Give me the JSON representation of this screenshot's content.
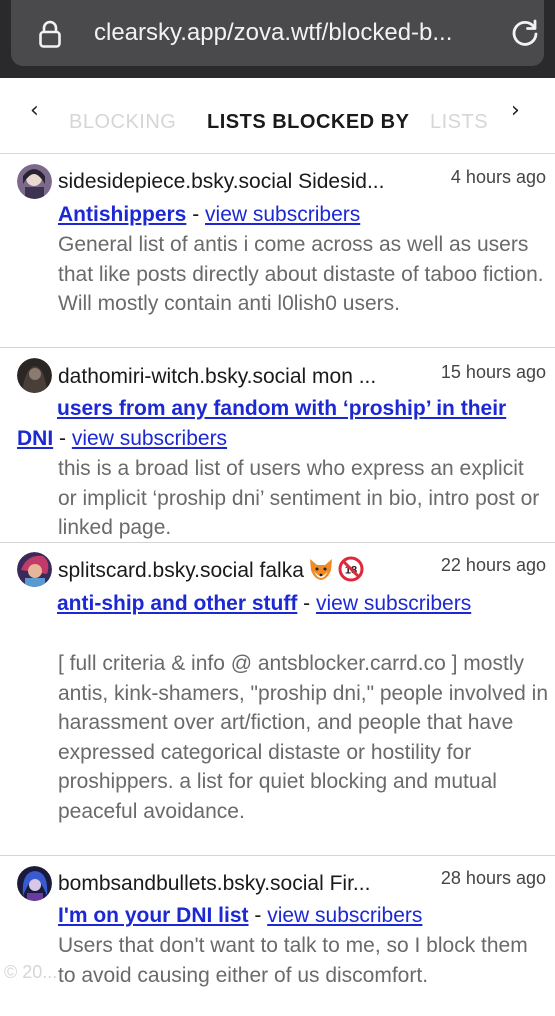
{
  "browser": {
    "url": "clearsky.app/zova.wtf/blocked-b..."
  },
  "tabs": {
    "prev_label": "‹",
    "next_label": "›",
    "items": [
      "BLOCKING",
      "LISTS BLOCKED BY",
      "LISTS"
    ],
    "active": "LISTS BLOCKED BY"
  },
  "entries": [
    {
      "handle": "sidesidepiece.bsky.social Sidesid...",
      "time": "4 hours ago",
      "list_name": "Antishippers",
      "separator": " - ",
      "subscribers_label": "view subscribers",
      "description": "General list of antis i come across as well as users that like posts directly about distaste of taboo fiction. Will mostly contain anti l0lish0 users."
    },
    {
      "handle": "dathomiri-witch.bsky.social mon ...",
      "time": "15 hours ago",
      "list_name": "users from any fandom with ‘proship’ in their DNI",
      "separator": " - ",
      "subscribers_label": "view subscribers",
      "description": "this is a broad list of users who express an explicit or implicit ‘proship dni’ sentiment in bio, intro post or linked page."
    },
    {
      "handle": "splitscard.bsky.social falka",
      "time": "22 hours ago",
      "list_name": "anti-ship and other stuff",
      "separator": " - ",
      "subscribers_label": "view subscribers",
      "description": "[ full criteria & info @ antsblocker.carrd.co ] mostly antis, kink-shamers, \"proship dni,\" people involved in harassment over art/fiction, and people that have expressed categorical distaste or hostility for proshippers. a list for quiet blocking and mutual peaceful avoidance."
    },
    {
      "handle": "bombsandbullets.bsky.social Fir...",
      "time": "28 hours ago",
      "list_name": "I'm on your DNI list",
      "separator": " - ",
      "subscribers_label": "view subscribers",
      "description": "Users that don't want to talk to me, so I block them to avoid causing either of us discomfort."
    }
  ],
  "icons": {
    "lock": "lock-icon",
    "reload": "reload-icon",
    "fox": "fox-emoji-icon",
    "no18": "no-under-18-icon"
  },
  "colors": {
    "link": "#1c29d3",
    "browser_bg": "#2a2a2c",
    "url_pill": "#4a4a4d",
    "description": "#6a6a6a"
  },
  "watermark": "© 20..."
}
